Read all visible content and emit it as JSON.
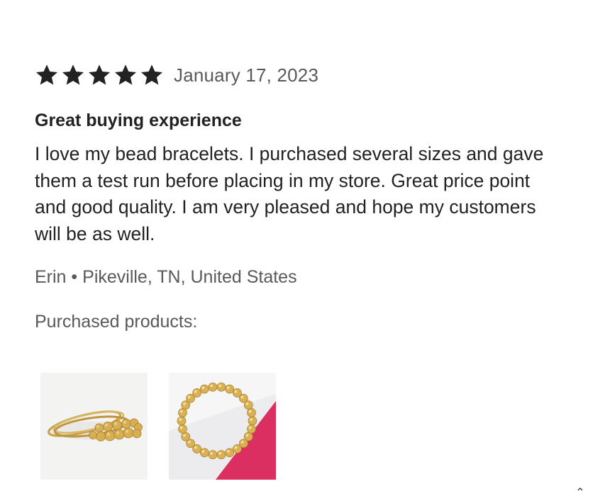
{
  "review": {
    "rating": 5,
    "rating_max": 5,
    "star_color": "#222222",
    "date": "January 17, 2023",
    "title": "Great buying experience",
    "body": "I love my bead bracelets. I purchased several sizes and gave them a test run before placing in my store. Great price point and good quality. I am very pleased and hope my customers will be as well.",
    "author": "Erin",
    "separator": "•",
    "location": "Pikeville, TN, United States"
  },
  "purchased": {
    "label": "Purchased products:",
    "products": [
      {
        "image": "gold-stacked-bead-bracelets-photo"
      },
      {
        "image": "gold-bead-bracelet-on-pink-photo"
      }
    ]
  }
}
